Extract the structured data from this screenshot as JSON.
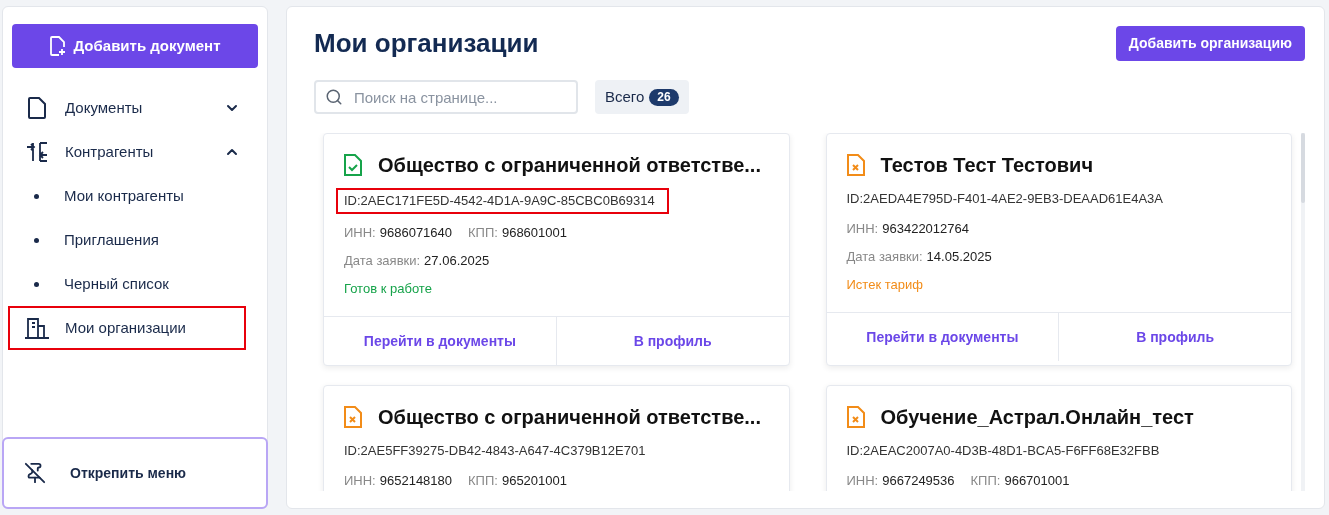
{
  "sidebar": {
    "add_button": "Добавить документ",
    "items": [
      {
        "kind": "documents",
        "label": "Документы",
        "expanded": false,
        "highlighted": false
      },
      {
        "kind": "contractors",
        "label": "Контрагенты",
        "expanded": true,
        "highlighted": false,
        "children": [
          {
            "label": "Мои контрагенты"
          },
          {
            "label": "Приглашения"
          },
          {
            "label": "Черный список"
          }
        ]
      },
      {
        "kind": "organizations",
        "label": "Мои организации",
        "highlighted": true
      }
    ],
    "unpin": "Открепить меню"
  },
  "page": {
    "title": "Мои организации",
    "add_button": "Добавить организацию",
    "search": {
      "placeholder": "Поиск на странице..."
    },
    "total": {
      "label": "Всего",
      "count": "26"
    }
  },
  "cards": [
    {
      "kind": "ready",
      "title": "Общество с ограниченной ответстве...",
      "id": "ID:2AEC171FE5D-4542-4D1A-9A9C-85CBC0B69314",
      "id_highlighted": true,
      "inn_label": "ИНН:",
      "inn": "9686071640",
      "kpp_label": "КПП:",
      "kpp": "968601001",
      "date_label": "Дата заявки:",
      "date": "27.06.2025",
      "status": "Готов к работе",
      "actions": [
        "Перейти в документы",
        "В профиль"
      ]
    },
    {
      "kind": "expired",
      "title": "Тестов Тест Тестович",
      "id": "ID:2AEDA4E795D-F401-4AE2-9EB3-DEAAD61E4A3A",
      "id_highlighted": false,
      "inn_label": "ИНН:",
      "inn": "963422012764",
      "date_label": "Дата заявки:",
      "date": "14.05.2025",
      "status": "Истек тариф",
      "actions": [
        "Перейти в документы",
        "В профиль"
      ]
    },
    {
      "kind": "expired",
      "title": "Общество с ограниченной ответстве...",
      "id": "ID:2AE5FF39275-DB42-4843-A647-4C379B12E701",
      "id_highlighted": false,
      "inn_label": "ИНН:",
      "inn": "9652148180",
      "kpp_label": "КПП:",
      "kpp": "965201001"
    },
    {
      "kind": "expired",
      "title": "Обучение_Астрал.Онлайн_тест",
      "id": "ID:2AEAC2007A0-4D3B-48D1-BCA5-F6FF68E32FBB",
      "id_highlighted": false,
      "inn_label": "ИНН:",
      "inn": "9667249536",
      "kpp_label": "КПП:",
      "kpp": "966701001"
    }
  ]
}
